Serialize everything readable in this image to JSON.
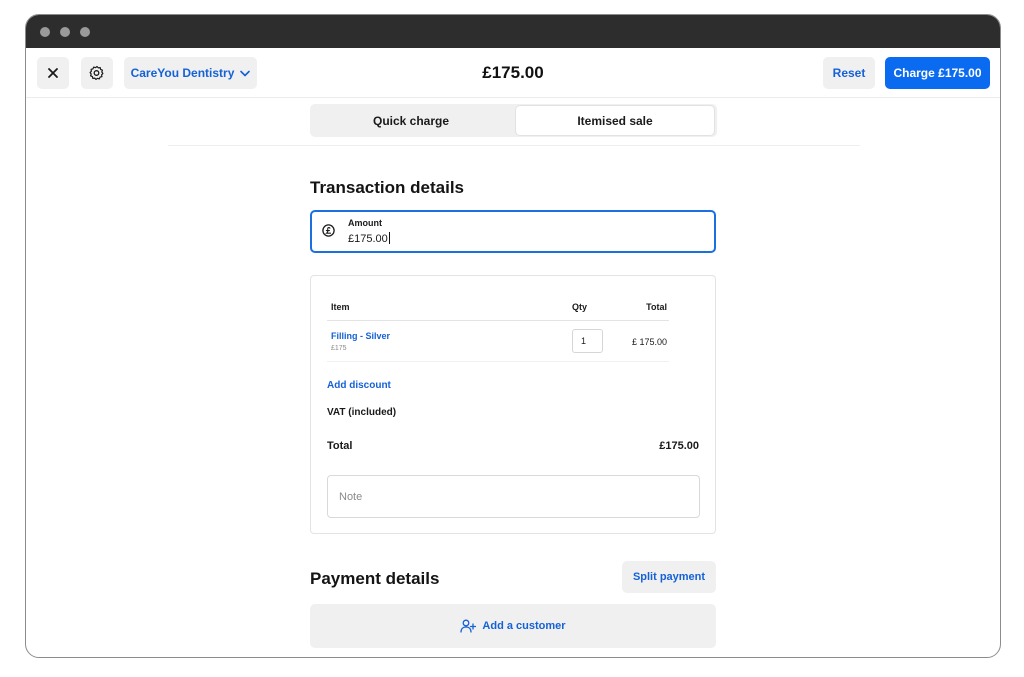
{
  "header": {
    "location": "CareYou Dentistry",
    "amount": "£175.00",
    "reset_label": "Reset",
    "charge_label": "Charge £175.00"
  },
  "tabs": [
    {
      "label": "Quick charge",
      "active": false
    },
    {
      "label": "Itemised sale",
      "active": true
    }
  ],
  "transaction": {
    "title": "Transaction details",
    "amount_label": "Amount",
    "amount_value": "£175.00"
  },
  "items": {
    "headers": {
      "item": "Item",
      "qty": "Qty",
      "total": "Total"
    },
    "rows": [
      {
        "name": "Filling - Silver",
        "price": "£175",
        "qty": "1",
        "total": "£ 175.00"
      }
    ],
    "add_discount": "Add discount",
    "vat_label": "VAT (included)",
    "total_label": "Total",
    "total_value": "£175.00",
    "note_placeholder": "Note"
  },
  "payment": {
    "title": "Payment details",
    "split_label": "Split payment",
    "add_customer_label": "Add a customer"
  },
  "colors": {
    "accent": "#0b6bf0",
    "link": "#1561d6",
    "titlebar": "#2d2d2d"
  }
}
